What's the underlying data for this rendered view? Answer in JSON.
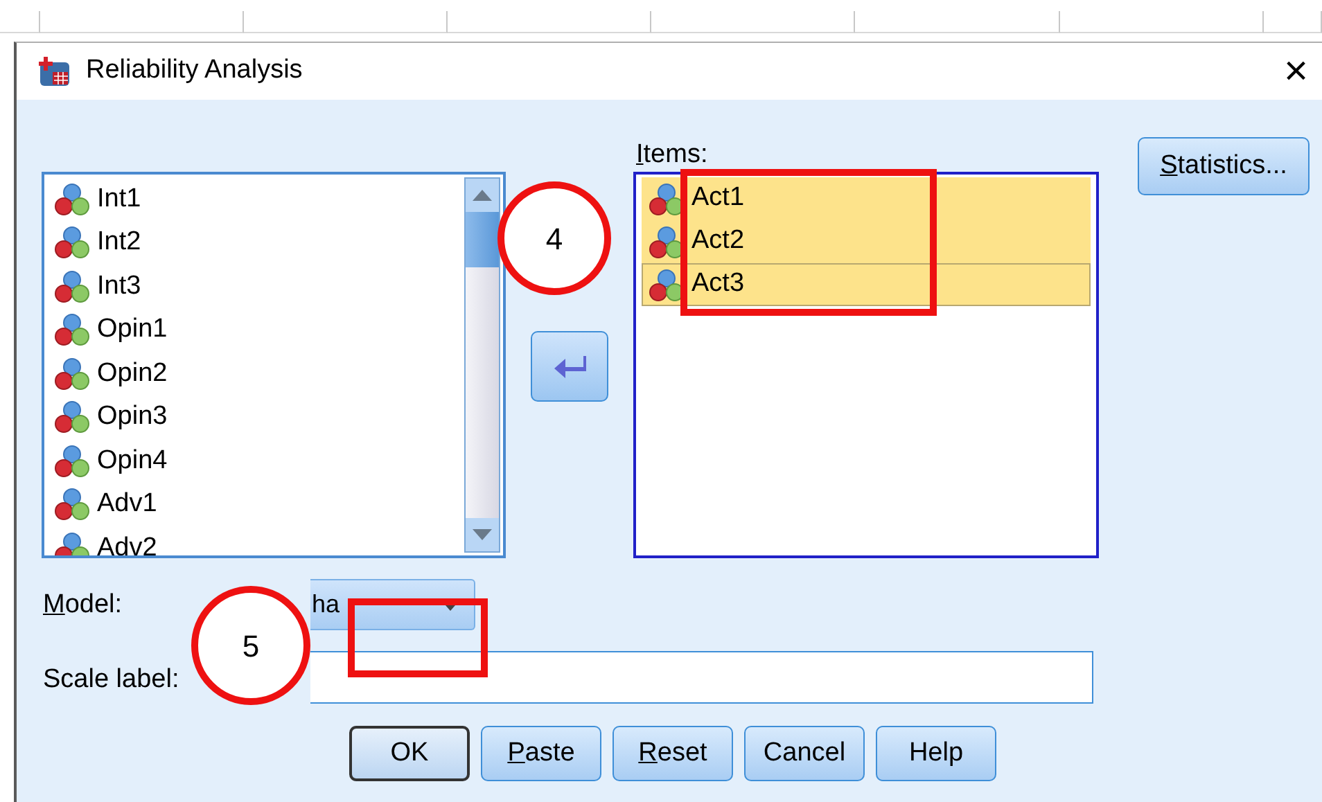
{
  "window": {
    "title": "Reliability Analysis",
    "close": "×"
  },
  "variables": [
    {
      "label": "Int1",
      "selected": false
    },
    {
      "label": "Int2",
      "selected": false
    },
    {
      "label": "Int3",
      "selected": false
    },
    {
      "label": "Opin1",
      "selected": false
    },
    {
      "label": "Opin2",
      "selected": false
    },
    {
      "label": "Opin3",
      "selected": false
    },
    {
      "label": "Opin4",
      "selected": false
    },
    {
      "label": "Adv1",
      "selected": false
    },
    {
      "label": "Adv2",
      "selected": false
    }
  ],
  "items": {
    "label": "Items:",
    "mnemonic": true,
    "rows": [
      {
        "label": "Act1",
        "selected": true,
        "focused": false
      },
      {
        "label": "Act2",
        "selected": true,
        "focused": false
      },
      {
        "label": "Act3",
        "selected": true,
        "focused": true
      }
    ]
  },
  "statistics_button": {
    "label": "Statistics...",
    "mnemonic": true
  },
  "model": {
    "label": "Model:",
    "mnemonic": true,
    "value": "ha"
  },
  "scale_label": {
    "label": "Scale label:"
  },
  "buttons": [
    {
      "label": "OK",
      "mnemonic": false,
      "default": true
    },
    {
      "label": "Paste",
      "mnemonic": true,
      "default": false
    },
    {
      "label": "Reset",
      "mnemonic": true,
      "default": false
    },
    {
      "label": "Cancel",
      "mnemonic": false,
      "default": false
    },
    {
      "label": "Help",
      "mnemonic": false,
      "default": false
    }
  ],
  "annotations": [
    {
      "kind": "circle",
      "label": "4"
    },
    {
      "kind": "circle",
      "label": "5"
    },
    {
      "kind": "rect"
    },
    {
      "kind": "rect"
    }
  ]
}
